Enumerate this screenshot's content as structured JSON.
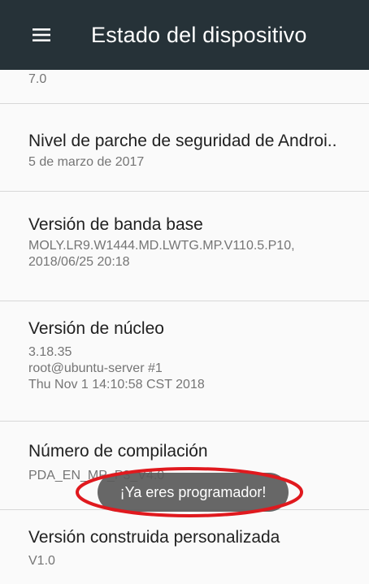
{
  "appbar": {
    "title": "Estado del dispositivo",
    "menu_icon": "hamburger-menu-icon",
    "background": "#263238"
  },
  "items": [
    {
      "title": "",
      "summary": "7.0"
    },
    {
      "title": "Nivel de parche de seguridad de Androi..",
      "summary": "5 de marzo de 2017"
    },
    {
      "title": "Versión de banda base",
      "summary": "MOLY.LR9.W1444.MD.LWTG.MP.V110.5.P10,\n2018/06/25 20:18"
    },
    {
      "title": "Versión de núcleo",
      "summary": "3.18.35\nroot@ubuntu-server #1\nThu Nov 1 14:10:58 CST 2018"
    },
    {
      "title": "Número de compilación",
      "summary": "PDA_EN_MP_P3_V4.0"
    },
    {
      "title": "Versión construida personalizada",
      "summary": "V1.0"
    }
  ],
  "toast": {
    "text": "¡Ya eres programador!",
    "highlight_color": "#e0191e"
  }
}
